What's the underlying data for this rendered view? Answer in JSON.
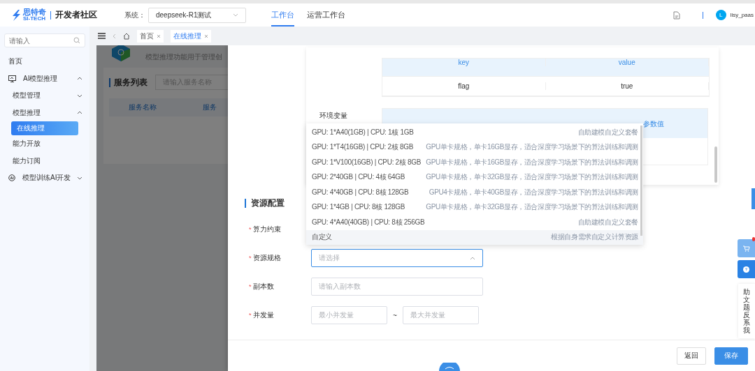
{
  "header": {
    "logo_cn": "思特奇",
    "logo_en": "SI-TECH",
    "site": "开发者社区",
    "system_label": "系统：",
    "system_value": "deepseek-R1测试",
    "tabs": [
      {
        "label": "工作台",
        "selected": true
      },
      {
        "label": "运营工作台",
        "selected": false
      }
    ],
    "user": {
      "initial": "L",
      "name": "lisy_paas"
    }
  },
  "sidebar": {
    "search_placeholder": "请输入",
    "items": [
      {
        "label": "首页",
        "selected": false
      },
      {
        "label": "AI模型推理",
        "expanded": true,
        "selected": false,
        "children": [
          {
            "label": "模型管理",
            "expanded": false,
            "selected": false
          },
          {
            "label": "模型推理",
            "expanded": true,
            "selected": false,
            "children": [
              {
                "label": "在线推理",
                "selected": true
              }
            ]
          },
          {
            "label": "能力开放",
            "selected": false
          },
          {
            "label": "能力订阅",
            "selected": false
          }
        ]
      },
      {
        "label": "模型训练AI开发",
        "expanded": false,
        "selected": false
      }
    ]
  },
  "tag_bar": {
    "tags": [
      {
        "label": "首页",
        "selected": false
      },
      {
        "label": "在线推理",
        "selected": true
      }
    ]
  },
  "background_page": {
    "description": "模型推理功能用于管理创",
    "list_title": "服务列表",
    "search_placeholder": "请输入服务名称",
    "columns": [
      "服务名称",
      "服务"
    ]
  },
  "drawer": {
    "key_table": {
      "columns": [
        "key",
        "value"
      ],
      "rows": [
        [
          "flag",
          "true"
        ]
      ]
    },
    "env_label": "环境变量",
    "env_table": {
      "visible_header": "参数值"
    },
    "section_title": "资源配置",
    "form": [
      {
        "label": "算力约束",
        "required_mark": "*",
        "kind": "covered"
      },
      {
        "label": "资源规格",
        "required_mark": "*",
        "kind": "select",
        "placeholder": "请选择",
        "focused": true
      },
      {
        "label": "副本数",
        "required_mark": "*",
        "kind": "input",
        "placeholder": "请输入副本数"
      },
      {
        "label": "并发量",
        "required_mark": "*",
        "kind": "range",
        "placeholder": "最小并发量",
        "separator": "~",
        "placeholder_2": "最大并发量"
      }
    ],
    "dropdown": [
      {
        "spec": "GPU: 1*A40(1GB) | CPU: 1核 1GB",
        "note": "自助建模自定义套餐",
        "highlighted": false
      },
      {
        "spec": "GPU: 1*T4(16GB) | CPU: 2核 8GB",
        "note": "GPU单卡规格，单卡16GB显存，适合深度学习场景下的算法训练和调测",
        "highlighted": false
      },
      {
        "spec": "GPU: 1*V100(16GB) | CPU: 2核 8GB",
        "note": "GPU单卡规格，单卡16GB显存，适合深度学习场景下的算法训练和调测",
        "highlighted": false
      },
      {
        "spec": "GPU: 2*40GB | CPU: 4核 64GB",
        "note": "GPU单卡规格，单卡32GB显存，适合深度学习场景下的算法训练和调测",
        "highlighted": false
      },
      {
        "spec": "GPU: 4*40GB | CPU: 8核 128GB",
        "note": "GPU4卡规格，单卡40GB显存，适合深度学习场景下的算法训练和调测",
        "highlighted": false
      },
      {
        "spec": "GPU: 1*4GB | CPU: 8核 128GB",
        "note": "GPU单卡规格，单卡32GB显存，适合深度学习场景下的算法训练和调测",
        "highlighted": false
      },
      {
        "spec": "GPU: 4*A40(40GB) | CPU: 8核 256GB",
        "note": "自助建模自定义套餐",
        "highlighted": false
      },
      {
        "spec": "自定义",
        "note": "根据自身需求自定义计算资源",
        "highlighted": true
      }
    ],
    "buttons": [
      {
        "label": "返回",
        "kind": "secondary"
      },
      {
        "label": "保存",
        "kind": "primary"
      }
    ]
  },
  "float_bar": {
    "cart_badge": true,
    "vertical_text": "助文题反系我"
  }
}
